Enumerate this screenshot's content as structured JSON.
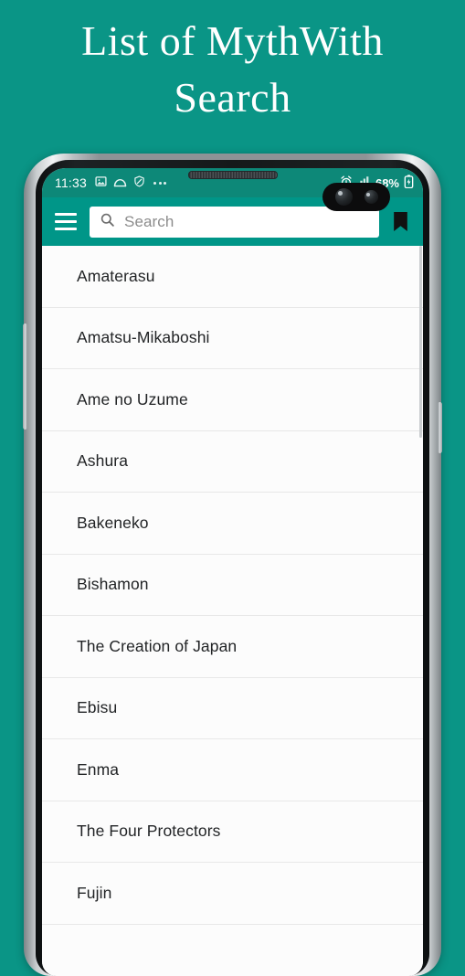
{
  "promo": {
    "title": "List of MythWith\nSearch",
    "background_color": "#0a9586",
    "title_color": "#ffffff"
  },
  "device": {
    "frame_color": "#8e9396",
    "buttons": [
      {
        "name": "volume-rocker"
      },
      {
        "name": "power-button"
      }
    ]
  },
  "status_bar": {
    "clock": "11:33",
    "background_color": "#0d8878",
    "left_icons": [
      "image-icon",
      "cloud-icon",
      "do-not-disturb-icon",
      "more-dots-icon"
    ],
    "right_icons": [
      "alarm-icon",
      "signal-bars-icon",
      "battery-icon"
    ],
    "battery_text": "68%"
  },
  "toolbar": {
    "background_color": "#009688",
    "menu_icon": "hamburger-menu-icon",
    "bookmark_icon": "bookmark-icon",
    "bookmark_color": "#111111"
  },
  "search": {
    "placeholder": "Search",
    "value": "",
    "icon": "search-icon",
    "icon_color": "#6d6d6d",
    "background_color": "#ffffff"
  },
  "list": {
    "background_color": "#fcfcfc",
    "divider_color": "#e8e8e8",
    "scrollbar_visible": true,
    "items": [
      {
        "label": "Amaterasu"
      },
      {
        "label": "Amatsu-Mikaboshi"
      },
      {
        "label": "Ame no Uzume"
      },
      {
        "label": "Ashura"
      },
      {
        "label": "Bakeneko"
      },
      {
        "label": "Bishamon"
      },
      {
        "label": "The Creation of Japan"
      },
      {
        "label": "Ebisu"
      },
      {
        "label": "Enma"
      },
      {
        "label": "The Four Protectors"
      },
      {
        "label": "Fujin"
      }
    ]
  }
}
